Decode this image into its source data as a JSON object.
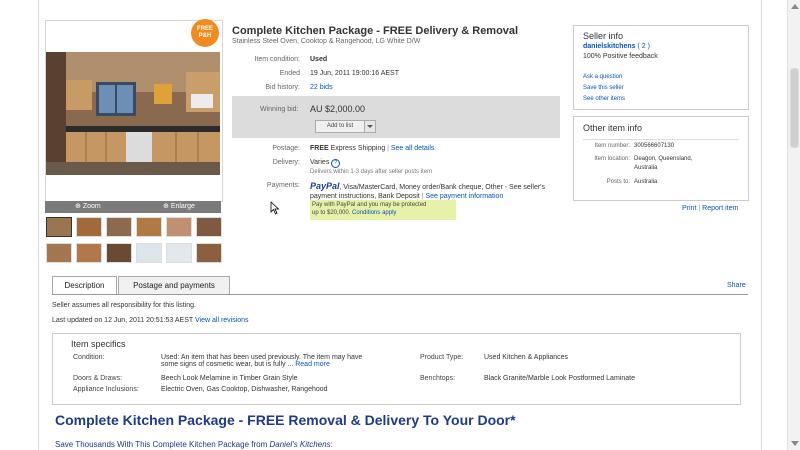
{
  "badge": {
    "line1": "FREE",
    "line2": "P&H"
  },
  "zoom": {
    "zoom_label": "Zoom",
    "enlarge_label": "Enlarge"
  },
  "item": {
    "title": "Complete Kitchen Package - FREE Delivery & Removal",
    "subtitle": "Stainless Steel Oven, Cooktop & Rangehood, LG White D/W",
    "condition_label": "Item condition:",
    "condition_value": "Used",
    "ended_label": "Ended",
    "ended_value": "19 Jun, 2011 19:00:16 AEST",
    "bid_history_label": "Bid history:",
    "bid_history_value": "22 bids",
    "winning_bid_label": "Winning bid:",
    "winning_bid_value": "AU $2,000.00",
    "add_to_list": "Add to list",
    "postage_label": "Postage:",
    "postage_free": "FREE",
    "postage_method": "Express Shipping",
    "postage_sep": "|",
    "postage_link": "See all details",
    "delivery_label": "Delivery:",
    "delivery_value": "Varies",
    "delivery_note": "Delivers within 1-3 days after seller posts item",
    "payments_label": "Payments:",
    "payments_logo": "PayPal",
    "payments_text": ", Visa/MasterCard, Money order/Bank cheque, Other - See seller's payment instructions, Bank Deposit",
    "payments_sep": "|",
    "payments_link": "See payment information",
    "paypal_note_line1": "Pay with PayPal and you may be protected",
    "paypal_note_line2": "up to $20,000.",
    "paypal_note_link": "Conditions apply"
  },
  "seller": {
    "heading": "Seller info",
    "name": "danielskitchens",
    "feedback_score": "( 2 )",
    "feedback_pct": "100% Positive feedback",
    "links": [
      "Ask a question",
      "Save this seller",
      "See other items"
    ]
  },
  "other_info": {
    "heading": "Other item info",
    "item_number_label": "Item number:",
    "item_number_value": "300566607130",
    "location_label": "Item location:",
    "location_value_line1": "Deagon, Queensland,",
    "location_value_line2": "Australia",
    "posts_to_label": "Posts to:",
    "posts_to_value": "Australia"
  },
  "actions": {
    "print": "Print",
    "sep": "|",
    "report": "Report item"
  },
  "tabs": [
    "Description",
    "Postage and payments"
  ],
  "share": "Share",
  "description": {
    "responsibility": "Seller assumes all responsibility for this listing.",
    "updated_prefix": "Last updated on",
    "updated_value": "12 Jun, 2011 20:51:53 AEST",
    "revisions_link": "View all revisions"
  },
  "specifics": {
    "heading": "Item specifics",
    "condition_label": "Condition:",
    "condition_value_line1": "Used: An item that has been used previously. The item may have",
    "condition_value_line2": "some signs of cosmetic wear, but is fully ...",
    "read_more": "Read more",
    "product_type_label": "Product Type:",
    "product_type_value": "Used Kitchen & Appliances",
    "doors_label": "Doors & Draws:",
    "doors_value": "Beech Look Melamine in Timber Grain Style",
    "benchtops_label": "Benchtops:",
    "benchtops_value": "Black Granite/Marble Look Postformed Laminate",
    "appliances_label": "Appliance Inclusions:",
    "appliances_value": "Electric Oven, Gas Cooktop, Dishwasher, Rangehood"
  },
  "listing": {
    "headline": "Complete Kitchen Package - FREE Removal & Delivery To Your Door*",
    "subline_prefix": "Save Thousands With This Complete Kitchen Package from",
    "subline_name": "Daniel's Kitchens",
    "subline_suffix": ":"
  }
}
